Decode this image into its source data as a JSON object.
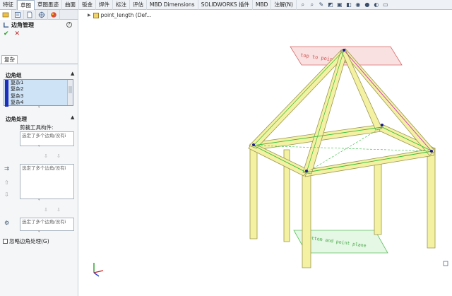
{
  "ribbon": {
    "tabs": [
      "特征",
      "草图",
      "草图墨迹",
      "曲面",
      "钣金",
      "焊件",
      "标注",
      "评估",
      "MBD Dimensions",
      "SOLIDWORKS 插件",
      "MBD",
      "注解(N)"
    ],
    "active_tab": "草图"
  },
  "property_manager": {
    "title": "边角管理",
    "mode_tab": "复杂",
    "corner_group": {
      "heading": "边角组",
      "items": [
        "复杂1",
        "复杂2",
        "复杂3",
        "复杂4"
      ]
    },
    "corner_processing": {
      "heading": "边角处理",
      "trim_tool_label": "剪裁工具构件:",
      "box_placeholder": "选定了多个边角/没有i",
      "box2_placeholder": "选定了多个边角/没有i",
      "box3_placeholder": "选定了多个边角/没有i"
    },
    "ignore_label": "忽略边角处理(G)"
  },
  "feature_tree": {
    "label": "point_length  (Def..."
  },
  "viewport": {
    "plane_top_label": "top to point plane",
    "plane_bottom_label": "bottom and point plane",
    "colors": {
      "beam": "#f4f1a3",
      "beam_edge": "#9b9750",
      "sketch_green": "#2dbb3a",
      "sketch_magenta": "#c832c8",
      "plane_red": "#e98b8b",
      "plane_green": "#8fdc8f",
      "vertex": "#1a1a8c"
    }
  }
}
